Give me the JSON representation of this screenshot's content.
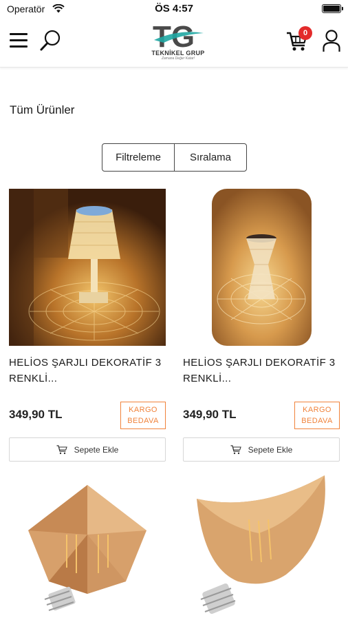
{
  "status_bar": {
    "carrier": "Operatör",
    "time": "ÖS 4:57"
  },
  "header": {
    "logo_mark": "TG",
    "logo_name": "TEKNİKEL GRUP",
    "logo_tagline": "Zamana Değer Katar!",
    "cart_count": "0"
  },
  "page_title": "Tüm Ürünler",
  "toolbar": {
    "filter_label": "Filtreleme",
    "sort_label": "Sıralama"
  },
  "products": [
    {
      "name": "HELİOS ŞARJLI DEKORATİF 3 RENKLİ...",
      "price": "349,90 TL",
      "badge": "KARGO BEDAVA",
      "add_label": "Sepete Ekle"
    },
    {
      "name": "HELİOS ŞARJLI DEKORATİF 3 RENKLİ...",
      "price": "349,90 TL",
      "badge": "KARGO BEDAVA",
      "add_label": "Sepete Ekle"
    }
  ],
  "colors": {
    "accent_badge": "#f0823a",
    "cart_badge": "#e32b2b",
    "logo_teal": "#1fa7a3",
    "logo_gray": "#4a4a4a"
  }
}
